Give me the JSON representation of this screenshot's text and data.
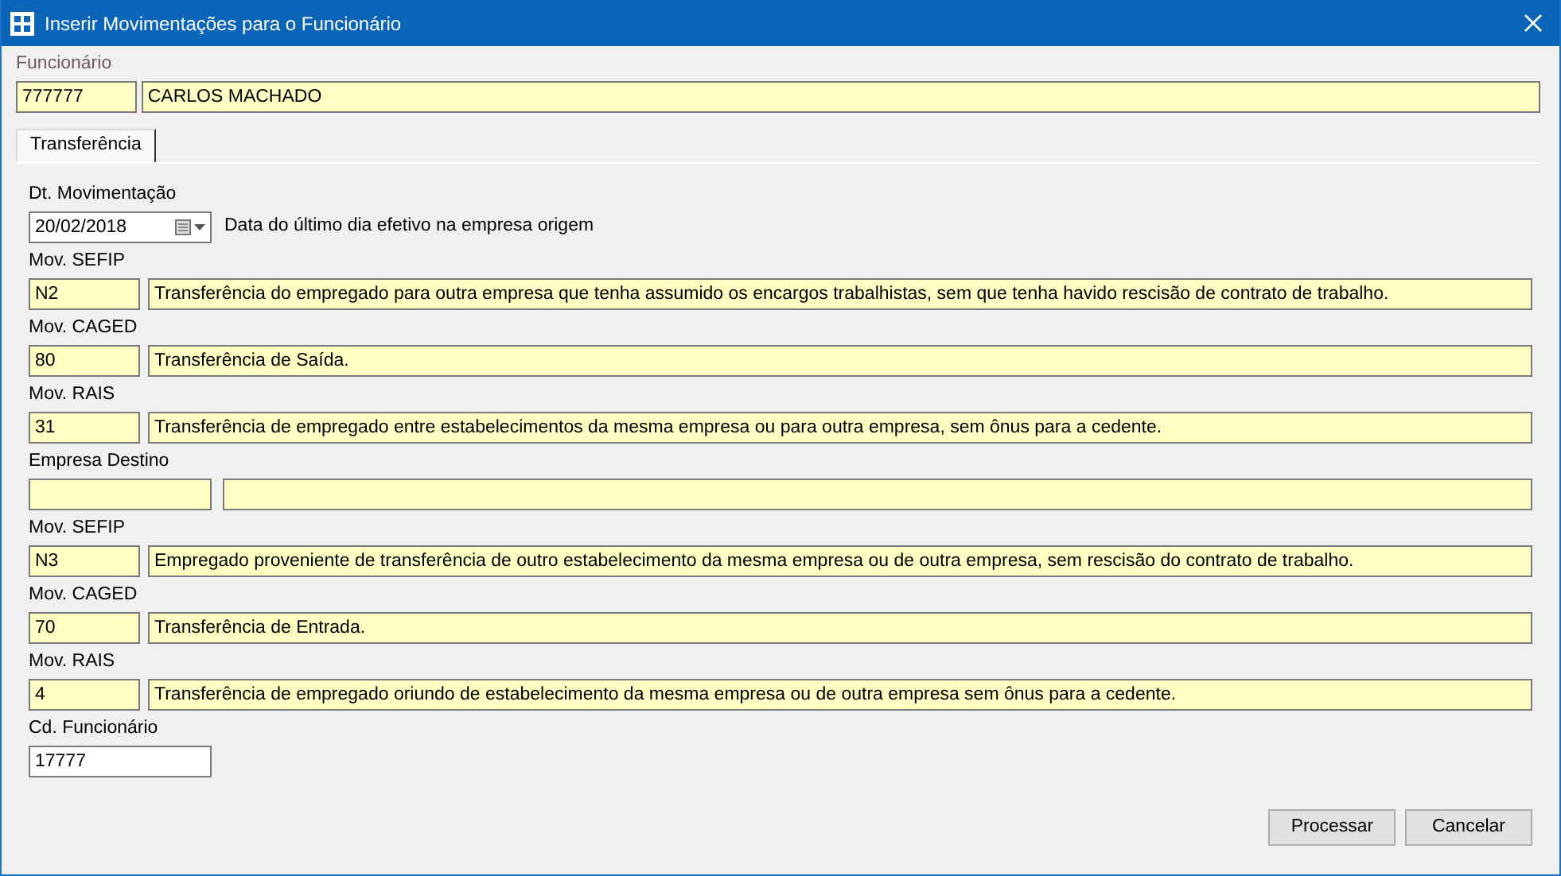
{
  "window": {
    "title": "Inserir Movimentações para o Funcionário"
  },
  "employee": {
    "label": "Funcionário",
    "code": "777777",
    "name": "CARLOS MACHADO"
  },
  "tabs": [
    {
      "label": "Transferência",
      "selected": true
    }
  ],
  "fields": [
    {
      "kind": "date",
      "label": "Dt. Movimentação",
      "value": "20/02/2018",
      "note": "Data do último dia efetivo na empresa origem"
    },
    {
      "kind": "coded",
      "label": "Mov. SEFIP",
      "code": "N2",
      "description": "Transferência do empregado para outra empresa que tenha assumido os encargos trabalhistas, sem que tenha havido rescisão de contrato de trabalho."
    },
    {
      "kind": "coded",
      "label": "Mov. CAGED",
      "code": "80",
      "description": "Transferência de Saída."
    },
    {
      "kind": "coded",
      "label": "Mov. RAIS",
      "code": "31",
      "description": "Transferência de empregado entre estabelecimentos da mesma empresa ou para outra empresa, sem ônus para a cedente."
    },
    {
      "kind": "pair",
      "label": "Empresa Destino"
    },
    {
      "kind": "coded",
      "label": "Mov. SEFIP",
      "code": "N3",
      "description": "Empregado proveniente de transferência de outro estabelecimento da mesma empresa ou de outra empresa, sem rescisão do contrato de trabalho."
    },
    {
      "kind": "coded",
      "label": "Mov. CAGED",
      "code": "70",
      "description": "Transferência de Entrada."
    },
    {
      "kind": "coded",
      "label": "Mov. RAIS",
      "code": "4",
      "description": "Transferência de empregado oriundo de estabelecimento da mesma empresa ou de outra empresa sem ônus para a cedente."
    },
    {
      "kind": "text",
      "label": "Cd. Funcionário",
      "value": "17777"
    }
  ],
  "buttons": [
    "Processar",
    "Cancelar"
  ]
}
